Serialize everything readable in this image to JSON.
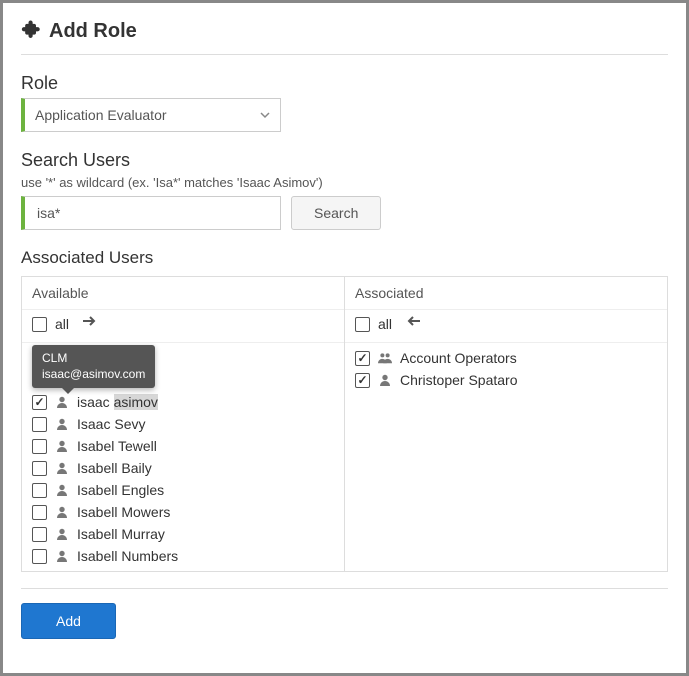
{
  "header": {
    "title": "Add Role"
  },
  "role": {
    "label": "Role",
    "selected": "Application Evaluator"
  },
  "search": {
    "label": "Search Users",
    "hint": "use '*' as wildcard (ex. 'Isa*' matches 'Isaac Asimov')",
    "value": "isa*",
    "button": "Search"
  },
  "associated_section": {
    "title": "Associated Users",
    "available_label": "Available",
    "associated_label": "Associated",
    "all_label": "all"
  },
  "tooltip": {
    "line1": "CLM",
    "line2": "isaac@asimov.com"
  },
  "available": [
    {
      "name": "isaac asimov",
      "checked": true,
      "type": "user",
      "highlight_start": 6
    },
    {
      "name": "Isaac Sevy",
      "checked": false,
      "type": "user"
    },
    {
      "name": "Isabel Tewell",
      "checked": false,
      "type": "user"
    },
    {
      "name": "Isabell Baily",
      "checked": false,
      "type": "user"
    },
    {
      "name": "Isabell Engles",
      "checked": false,
      "type": "user"
    },
    {
      "name": "Isabell Mowers",
      "checked": false,
      "type": "user"
    },
    {
      "name": "Isabell Murray",
      "checked": false,
      "type": "user"
    },
    {
      "name": "Isabell Numbers",
      "checked": false,
      "type": "user"
    }
  ],
  "associated": [
    {
      "name": "Account Operators",
      "checked": true,
      "type": "group"
    },
    {
      "name": "Christoper Spataro",
      "checked": true,
      "type": "user"
    }
  ],
  "footer": {
    "add": "Add"
  }
}
